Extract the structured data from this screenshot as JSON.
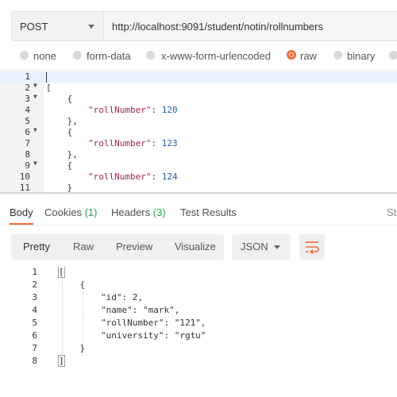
{
  "request": {
    "method": "POST",
    "url": "http://localhost:9091/student/notin/rollnumbers"
  },
  "body_types": [
    "none",
    "form-data",
    "x-www-form-urlencoded",
    "raw",
    "binary"
  ],
  "body_type_selected": "raw",
  "request_body": {
    "line_numbers": [
      "1",
      "2",
      "3",
      "4",
      "5",
      "6",
      "7",
      "8",
      "9",
      "10",
      "11"
    ],
    "lines": [
      {
        "indent": "",
        "key": "",
        "value": "",
        "punct": ""
      },
      {
        "indent": "",
        "key": "",
        "value": "",
        "punct": "["
      },
      {
        "indent": "    ",
        "key": "",
        "value": "",
        "punct": "{"
      },
      {
        "indent": "        ",
        "key": "\"rollNumber\"",
        "value": "120",
        "punct": ": "
      },
      {
        "indent": "    ",
        "key": "",
        "value": "",
        "punct": "},"
      },
      {
        "indent": "    ",
        "key": "",
        "value": "",
        "punct": "{"
      },
      {
        "indent": "        ",
        "key": "\"rollNumber\"",
        "value": "123",
        "punct": ": "
      },
      {
        "indent": "    ",
        "key": "",
        "value": "",
        "punct": "},"
      },
      {
        "indent": "    ",
        "key": "",
        "value": "",
        "punct": "{"
      },
      {
        "indent": "        ",
        "key": "\"rollNumber\"",
        "value": "124",
        "punct": ": "
      },
      {
        "indent": "    ",
        "key": "",
        "value": "",
        "punct": "}"
      }
    ]
  },
  "response_tabs": {
    "body": "Body",
    "cookies": "Cookies",
    "cookies_count": "(1)",
    "headers": "Headers",
    "headers_count": "(3)",
    "test_results": "Test Results",
    "status_partial": "Sta"
  },
  "response_view": {
    "buttons": [
      "Pretty",
      "Raw",
      "Preview",
      "Visualize"
    ],
    "active": "Pretty",
    "format": "JSON"
  },
  "response_body": {
    "line_numbers": [
      "1",
      "2",
      "3",
      "4",
      "5",
      "6",
      "7",
      "8"
    ],
    "lines": [
      "[",
      "    {",
      "        \"id\": 2,",
      "        \"name\": \"mark\",",
      "        \"rollNumber\": \"121\",",
      "        \"university\": \"rgtu\"",
      "    }",
      "]"
    ]
  },
  "colors": {
    "accent": "#f26b3a",
    "count": "#26a65b",
    "json_key": "#a0274d",
    "json_value": "#1c5fa8"
  }
}
